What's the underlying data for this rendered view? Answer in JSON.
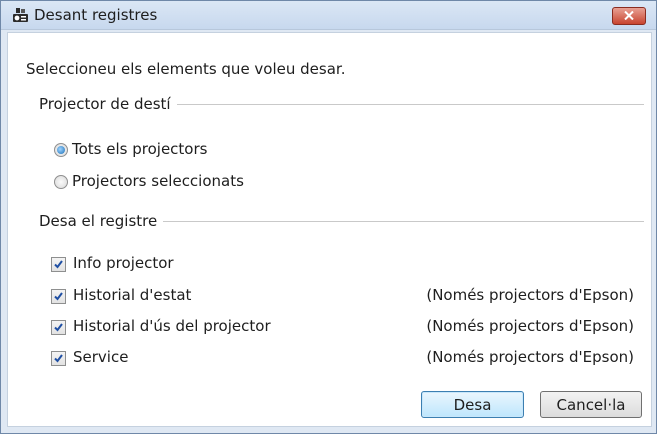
{
  "window": {
    "title": "Desant registres"
  },
  "instruction": "Seleccioneu els elements que voleu desar.",
  "target_group": {
    "label": "Projector de destí",
    "options": [
      {
        "label": "Tots els projectors",
        "selected": true
      },
      {
        "label": "Projectors seleccionats",
        "selected": false
      }
    ]
  },
  "log_group": {
    "label": "Desa el registre",
    "items": [
      {
        "label": "Info projector",
        "checked": true,
        "note": ""
      },
      {
        "label": "Historial d'estat",
        "checked": true,
        "note": "(Només projectors d'Epson)"
      },
      {
        "label": "Historial d'ús del projector",
        "checked": true,
        "note": "(Només projectors d'Epson)"
      },
      {
        "label": "Service",
        "checked": true,
        "note": "(Només projectors d'Epson)"
      }
    ]
  },
  "buttons": {
    "ok": "Desa",
    "cancel": "Cancel·la"
  },
  "colors": {
    "accent": "#3c7fb1",
    "close": "#c8442f",
    "check": "#1f4fa3"
  }
}
